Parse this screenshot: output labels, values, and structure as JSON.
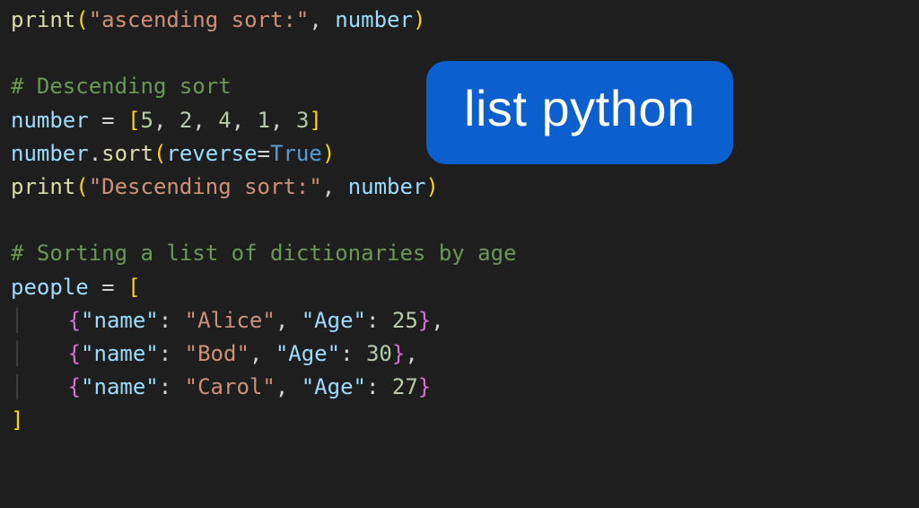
{
  "badge": {
    "label": "list python"
  },
  "code": {
    "l1": {
      "fn": "print",
      "open": "(",
      "str": "\"ascending sort:\"",
      "comma": ", ",
      "arg": "number",
      "close": ")"
    },
    "blank1": " ",
    "l2": {
      "comment": "# Descending sort"
    },
    "l3": {
      "var": "number",
      "eq": " = ",
      "open": "[",
      "n1": "5",
      "c1": ", ",
      "n2": "2",
      "c2": ", ",
      "n3": "4",
      "c3": ", ",
      "n4": "1",
      "c4": ", ",
      "n5": "3",
      "close": "]"
    },
    "l4": {
      "obj": "number",
      "dot": ".",
      "method": "sort",
      "open": "(",
      "param": "reverse",
      "eq": "=",
      "val": "True",
      "close": ")"
    },
    "l5": {
      "fn": "print",
      "open": "(",
      "str": "\"Descending sort:\"",
      "comma": ", ",
      "arg": "number",
      "close": ")"
    },
    "blank2": " ",
    "l6": {
      "comment": "# Sorting a list of dictionaries by age"
    },
    "l7": {
      "var": "people",
      "eq": " = ",
      "open": "["
    },
    "l8": {
      "indent": "    ",
      "open": "{",
      "k1": "\"name\"",
      "sep1": ": ",
      "v1": "\"Alice\"",
      "c1": ", ",
      "k2": "\"Age\"",
      "sep2": ": ",
      "v2": "25",
      "close": "}",
      "trail": ","
    },
    "l9": {
      "indent": "    ",
      "open": "{",
      "k1": "\"name\"",
      "sep1": ": ",
      "v1": "\"Bod\"",
      "c1": ", ",
      "k2": "\"Age\"",
      "sep2": ": ",
      "v2": "30",
      "close": "}",
      "trail": ","
    },
    "l10": {
      "indent": "    ",
      "open": "{",
      "k1": "\"name\"",
      "sep1": ": ",
      "v1": "\"Carol\"",
      "c1": ", ",
      "k2": "\"Age\"",
      "sep2": ": ",
      "v2": "27",
      "close": "}"
    },
    "l11": {
      "close": "]"
    }
  }
}
